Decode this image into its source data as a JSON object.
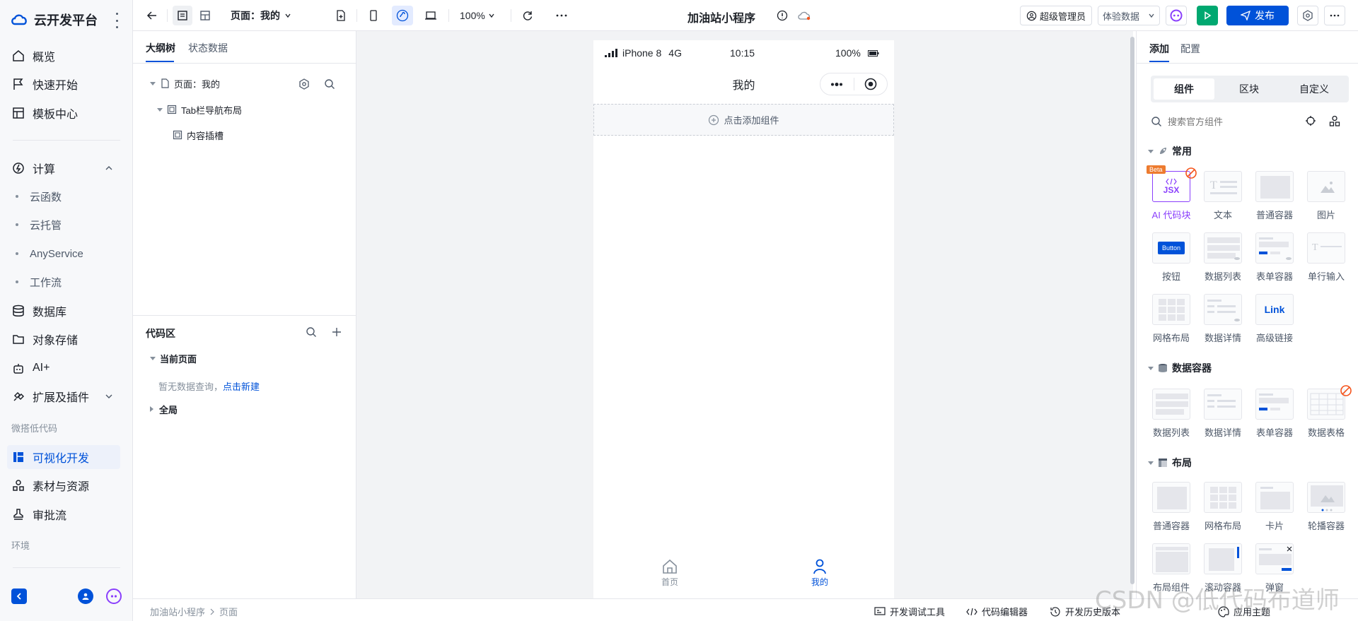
{
  "brand": {
    "name": "云开发平台"
  },
  "sidebar": {
    "items": [
      {
        "label": "概览"
      },
      {
        "label": "快速开始"
      },
      {
        "label": "模板中心"
      }
    ],
    "compute": {
      "label": "计算",
      "children": [
        "云函数",
        "云托管",
        "AnyService",
        "工作流"
      ]
    },
    "items2": [
      {
        "label": "数据库"
      },
      {
        "label": "对象存储"
      },
      {
        "label": "AI+"
      },
      {
        "label": "扩展及插件"
      }
    ],
    "group_label": "微搭低代码",
    "lowcode": [
      {
        "label": "可视化开发",
        "active": true
      },
      {
        "label": "素材与资源"
      },
      {
        "label": "审批流"
      }
    ],
    "env_label": "环境"
  },
  "toolbar": {
    "page_select": "页面：我的",
    "zoom": "100%",
    "app_title": "加油站小程序",
    "role": "超级管理员",
    "data_mode": "体验数据",
    "publish": "发布"
  },
  "outline": {
    "tabs": [
      "大纲树",
      "状态数据"
    ],
    "tree": [
      "页面：我的",
      "Tab栏导航布局",
      "内容插槽"
    ]
  },
  "code": {
    "title": "代码区",
    "current_page": "当前页面",
    "empty_text": "暂无数据查询，",
    "empty_link": "点击新建",
    "global": "全局"
  },
  "phone": {
    "device": "iPhone 8",
    "network": "4G",
    "time": "10:15",
    "battery": "100%",
    "nav_title": "我的",
    "add_component": "点击添加组件",
    "tabbar": [
      {
        "label": "首页",
        "active": false
      },
      {
        "label": "我的",
        "active": true
      }
    ]
  },
  "right": {
    "tabs": [
      "添加",
      "配置"
    ],
    "segments": [
      "组件",
      "区块",
      "自定义"
    ],
    "search_placeholder": "搜索官方组件",
    "sections": {
      "common": "常用",
      "data": "数据容器",
      "layout": "布局"
    },
    "common_items": [
      "AI 代码块",
      "文本",
      "普通容器",
      "图片",
      "按钮",
      "数据列表",
      "表单容器",
      "单行输入",
      "网格布局",
      "数据详情",
      "高级链接"
    ],
    "data_items": [
      "数据列表",
      "数据详情",
      "表单容器",
      "数据表格"
    ],
    "layout_items": [
      "普通容器",
      "网格布局",
      "卡片",
      "轮播容器",
      "布局组件",
      "滚动容器",
      "弹窗"
    ],
    "badge_beta": "Beta",
    "thumb_jsx": "JSX",
    "thumb_button": "Button",
    "thumb_link": "Link"
  },
  "status": {
    "breadcrumb": [
      "加油站小程序",
      "页面"
    ],
    "tools": [
      "开发调试工具",
      "代码编辑器",
      "开发历史版本",
      "应用主题"
    ]
  },
  "watermark": "CSDN @低代码布道师",
  "colors": {
    "accent": "#0052d9",
    "purple": "#8a3ffc",
    "green": "#00a870"
  }
}
